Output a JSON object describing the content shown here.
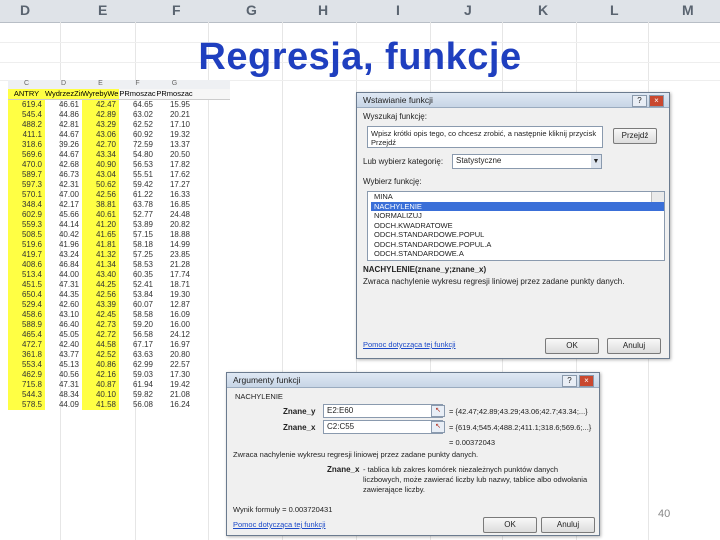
{
  "column_headers": [
    "D",
    "E",
    "F",
    "G",
    "H",
    "I",
    "J",
    "K",
    "L",
    "M"
  ],
  "slide_title": "Regresja, funkcje",
  "page_number": "40",
  "sheet": {
    "letters": [
      "C",
      "D",
      "E",
      "F",
      "G"
    ],
    "headers": [
      "ANTRY",
      "WydrzezZim",
      "WyrebyWer",
      "PRmoszac",
      "PRmoszac"
    ],
    "rows": [
      [
        "619.4",
        "46.61",
        "42.47",
        "64.65",
        "15.95"
      ],
      [
        "545.4",
        "44.86",
        "42.89",
        "63.02",
        "20.21"
      ],
      [
        "488.2",
        "42.81",
        "43.29",
        "62.52",
        "17.10"
      ],
      [
        "411.1",
        "44.67",
        "43.06",
        "60.92",
        "19.32"
      ],
      [
        "318.6",
        "39.26",
        "42.70",
        "72.59",
        "13.37"
      ],
      [
        "569.6",
        "44.67",
        "43.34",
        "54.80",
        "20.50"
      ],
      [
        "470.0",
        "42.68",
        "40.90",
        "56.53",
        "17.82"
      ],
      [
        "589.7",
        "46.73",
        "43.04",
        "55.51",
        "17.62"
      ],
      [
        "597.3",
        "42.31",
        "50.62",
        "59.42",
        "17.27"
      ],
      [
        "570.1",
        "47.00",
        "42.56",
        "61.22",
        "16.33"
      ],
      [
        "348.4",
        "42.17",
        "38.81",
        "63.78",
        "16.85"
      ],
      [
        "602.9",
        "45.66",
        "40.61",
        "52.77",
        "24.48"
      ],
      [
        "559.3",
        "44.14",
        "41.20",
        "53.89",
        "20.82"
      ],
      [
        "508.5",
        "40.42",
        "41.65",
        "57.15",
        "18.88"
      ],
      [
        "519.6",
        "41.96",
        "41.81",
        "58.18",
        "14.99"
      ],
      [
        "419.7",
        "43.24",
        "41.32",
        "57.25",
        "23.85"
      ],
      [
        "408.6",
        "46.84",
        "41.34",
        "58.53",
        "21.28"
      ],
      [
        "513.4",
        "44.00",
        "43.40",
        "60.35",
        "17.74"
      ],
      [
        "451.5",
        "47.31",
        "44.25",
        "52.41",
        "18.71"
      ],
      [
        "650.4",
        "44.35",
        "42.56",
        "53.84",
        "19.30"
      ],
      [
        "529.4",
        "42.60",
        "43.39",
        "60.07",
        "12.87"
      ],
      [
        "458.6",
        "43.10",
        "42.45",
        "58.58",
        "16.09"
      ],
      [
        "588.9",
        "46.40",
        "42.73",
        "59.20",
        "16.00"
      ],
      [
        "465.4",
        "45.05",
        "42.72",
        "56.58",
        "24.12"
      ],
      [
        "472.7",
        "42.40",
        "44.58",
        "67.17",
        "16.97"
      ],
      [
        "361.8",
        "43.77",
        "42.52",
        "63.63",
        "20.80"
      ],
      [
        "553.4",
        "45.13",
        "40.86",
        "62.99",
        "22.57"
      ],
      [
        "462.9",
        "40.56",
        "42.16",
        "59.03",
        "17.30"
      ],
      [
        "715.8",
        "47.31",
        "40.87",
        "61.94",
        "19.42"
      ],
      [
        "544.3",
        "48.34",
        "40.10",
        "59.82",
        "21.08"
      ],
      [
        "578.5",
        "44.09",
        "41.58",
        "56.08",
        "16.24"
      ]
    ]
  },
  "insert_dialog": {
    "title": "Wstawianie funkcji",
    "help_btn": "?",
    "close_btn": "×",
    "search_label": "Wyszukaj funkcję:",
    "search_text": "Wpisz krótki opis tego, co chcesz zrobić, a następnie kliknij przycisk Przejdź",
    "go_btn": "Przejdź",
    "category_label": "Lub wybierz kategorię:",
    "category_value": "Statystyczne",
    "select_label": "Wybierz funkcję:",
    "functions": [
      "MINA",
      "NACHYLENIE",
      "NORMALIZUJ",
      "ODCH.KWADRATOWE",
      "ODCH.STANDARDOWE.POPUL",
      "ODCH.STANDARDOWE.POPUL.A",
      "ODCH.STANDARDOWE.A"
    ],
    "selected_function": "NACHYLENIE",
    "signature": "NACHYLENIE(znane_y;znane_x)",
    "description": "Zwraca nachylenie wykresu regresji liniowej przez zadane punkty danych.",
    "help_link": "Pomoc dotycząca tej funkcji",
    "ok_btn": "OK",
    "cancel_btn": "Anuluj"
  },
  "args_dialog": {
    "title": "Argumenty funkcji",
    "help_btn": "?",
    "close_btn": "×",
    "func_name": "NACHYLENIE",
    "arg1_label": "Znane_y",
    "arg1_value": "E2:E60",
    "arg1_result": "= {42.47;42.89;43.29;43.06;42.7;43.34;...}",
    "arg2_label": "Znane_x",
    "arg2_value": "C2:C55",
    "arg2_result": "= {619.4;545.4;488.2;411.1;318.6;569.6;...}",
    "result": "= 0.00372043",
    "description": "Zwraca nachylenie wykresu regresji liniowej przez zadane punkty danych.",
    "arg_help_label": "Znane_x",
    "arg_help_text": "- tablica lub zakres komórek niezależnych punktów danych liczbowych, może zawierać liczby lub nazwy, tablice albo odwołania zawierające liczby.",
    "formula_result": "Wynik formuły = 0.003720431",
    "help_link": "Pomoc dotycząca tej funkcji",
    "ok_btn": "OK",
    "cancel_btn": "Anuluj",
    "collapse_icon": "↖"
  }
}
